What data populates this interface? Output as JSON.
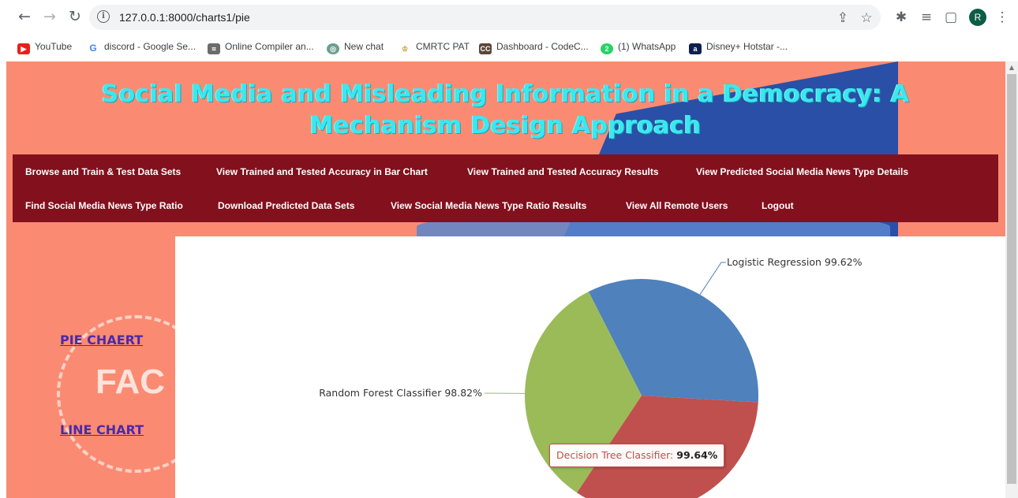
{
  "browser": {
    "url": "127.0.0.1:8000/charts1/pie",
    "profile_initial": "R",
    "bookmarks": [
      {
        "label": "YouTube",
        "icon": "youtube-icon"
      },
      {
        "label": "discord - Google Se...",
        "icon": "google-icon"
      },
      {
        "label": "Online Compiler an...",
        "icon": "compiler-icon"
      },
      {
        "label": "New chat",
        "icon": "chatgpt-icon"
      },
      {
        "label": "CMRTC PAT",
        "icon": "cmrtc-icon"
      },
      {
        "label": "Dashboard - CodeC...",
        "icon": "codechef-icon"
      },
      {
        "label": "(1) WhatsApp",
        "icon": "whatsapp-icon"
      },
      {
        "label": "Disney+ Hotstar -...",
        "icon": "hotstar-icon"
      }
    ]
  },
  "page": {
    "title": "Social Media and Misleading Information in a Democracy: A Mechanism Design Approach",
    "nav": [
      "Browse and Train & Test Data Sets",
      "View Trained and Tested Accuracy in Bar Chart",
      "View Trained and Tested Accuracy Results",
      "View Predicted Social Media News Type Details",
      "Find Social Media News Type Ratio",
      "Download Predicted Data Sets",
      "View Social Media News Type Ratio Results",
      "View All Remote Users",
      "Logout"
    ],
    "side_links": {
      "pie": "PIE CHAERT",
      "line": "LINE CHART"
    },
    "background_text": "FAC"
  },
  "chart_data": {
    "type": "pie",
    "title": "",
    "slices": [
      {
        "label": "Logistic Regression",
        "value": 99.62,
        "display": "Logistic Regression 99.62%",
        "color": "#4f81bd"
      },
      {
        "label": "Decision Tree Classifier",
        "value": 99.64,
        "display": "Decision Tree Classifier 99.64%",
        "color": "#c0504d"
      },
      {
        "label": "Random Forest Classifier",
        "value": 98.82,
        "display": "Random Forest Classifier 98.82%",
        "color": "#9bbb59"
      }
    ],
    "tooltip": {
      "label": "Decision Tree Classifier:",
      "value": "99.64%"
    }
  }
}
